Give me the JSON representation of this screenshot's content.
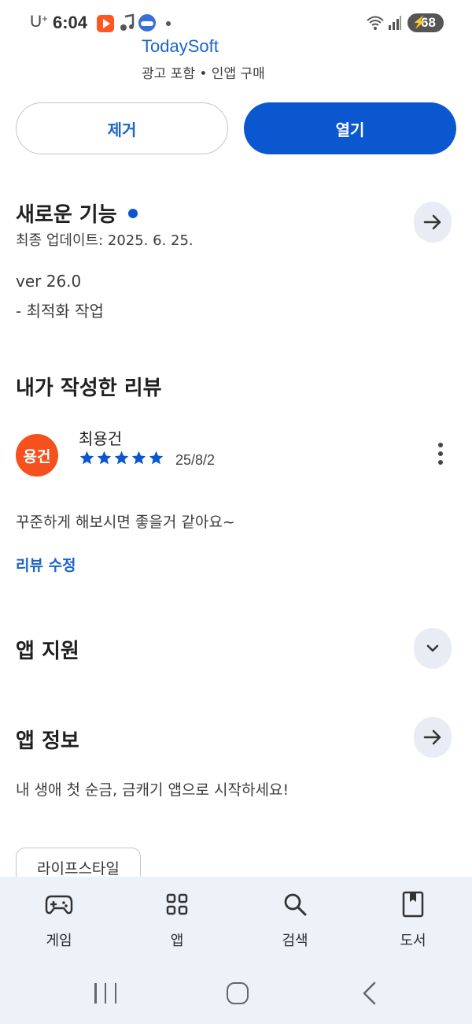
{
  "status_bar": {
    "carrier": "U",
    "carrier_sup": "+",
    "time": "6:04",
    "battery": "68",
    "icons": [
      "video-app-icon",
      "music-icon",
      "game-icon",
      "notification-dot",
      "wifi-icon",
      "signal-icon",
      "battery-icon"
    ]
  },
  "app": {
    "developer": "TodaySoft",
    "meta": "광고 포함 • 인앱 구매"
  },
  "actions": {
    "remove_label": "제거",
    "open_label": "열기"
  },
  "whats_new": {
    "title": "새로운 기능",
    "last_updated": "최종 업데이트: 2025. 6. 25.",
    "version": "ver 26.0",
    "notes": "- 최적화 작업"
  },
  "my_review": {
    "title": "내가 작성한 리뷰",
    "avatar_text": "용건",
    "reviewer": "최용건",
    "rating": 5,
    "rating_max": 5,
    "date": "25/8/2",
    "text": "꾸준하게 해보시면 좋을거 같아요~",
    "edit_label": "리뷰 수정"
  },
  "app_support": {
    "title": "앱 지원"
  },
  "app_info": {
    "title": "앱 정보",
    "description": "내 생애 첫 순금, 금캐기 앱으로 시작하세요!",
    "chip": "라이프스타일"
  },
  "bottom_nav": {
    "items": [
      {
        "label": "게임",
        "icon": "gamepad-icon"
      },
      {
        "label": "앱",
        "icon": "apps-grid-icon"
      },
      {
        "label": "검색",
        "icon": "search-icon"
      },
      {
        "label": "도서",
        "icon": "book-icon"
      }
    ]
  },
  "colors": {
    "accent": "#0b57d0",
    "link": "#1a65c9",
    "avatar": "#f4511e",
    "nav_background": "#edf1f8"
  }
}
